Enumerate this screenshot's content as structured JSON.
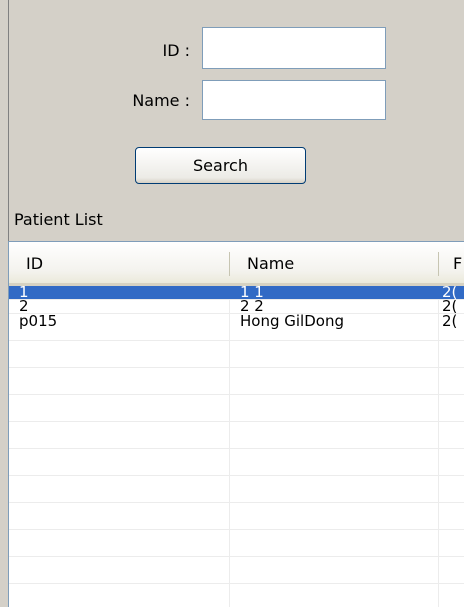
{
  "search_form": {
    "id_label": "ID :",
    "id_value": "",
    "name_label": "Name :",
    "name_value": "",
    "search_label": "Search"
  },
  "patient_list": {
    "section_label": "Patient List",
    "columns": [
      "ID",
      "Name",
      "F"
    ],
    "rows": [
      {
        "id": "1",
        "name": "1 1",
        "col3": "2(",
        "selected": true
      },
      {
        "id": "2",
        "name": "2 2",
        "col3": "2(",
        "selected": false
      },
      {
        "id": "p015",
        "name": "Hong GilDong",
        "col3": "2(",
        "selected": false
      }
    ]
  },
  "colors": {
    "window_bg": "#d4d0c8",
    "selection": "#316ac5",
    "input_border": "#7f9db9"
  }
}
